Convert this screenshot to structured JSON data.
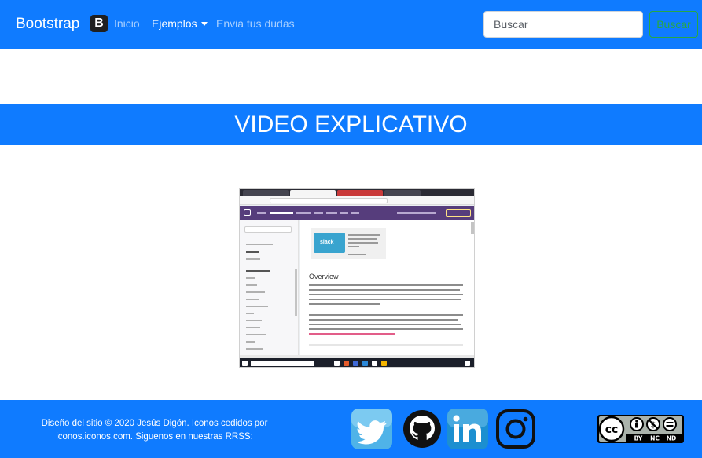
{
  "navbar": {
    "brand": "Bootstrap",
    "brand_logo_letter": "B",
    "links": [
      "Inicio",
      "Ejemplos",
      "Envia tus dudas"
    ],
    "search_placeholder": "Buscar",
    "search_button": "Buscar"
  },
  "main": {
    "title": "VIDEO EXPLICATIVO",
    "video": {
      "heading": "Overview",
      "ad_brand": "slack"
    }
  },
  "footer": {
    "credit_line1": "Diseño del sitio © 2020 Jesús Digón. Iconos cedidos por",
    "credit_line2": "iconos.iconos.com. Siguenos en nuestras RRSS:",
    "social": [
      "twitter-icon",
      "github-icon",
      "linkedin-icon",
      "instagram-icon"
    ],
    "license": {
      "cc": "cc",
      "terms": [
        "BY",
        "NC",
        "ND"
      ]
    }
  },
  "colors": {
    "primary": "#0f7bff",
    "success": "#28a745",
    "twitter": "#4fb3e8",
    "linkedin": "#1c8fd0"
  }
}
